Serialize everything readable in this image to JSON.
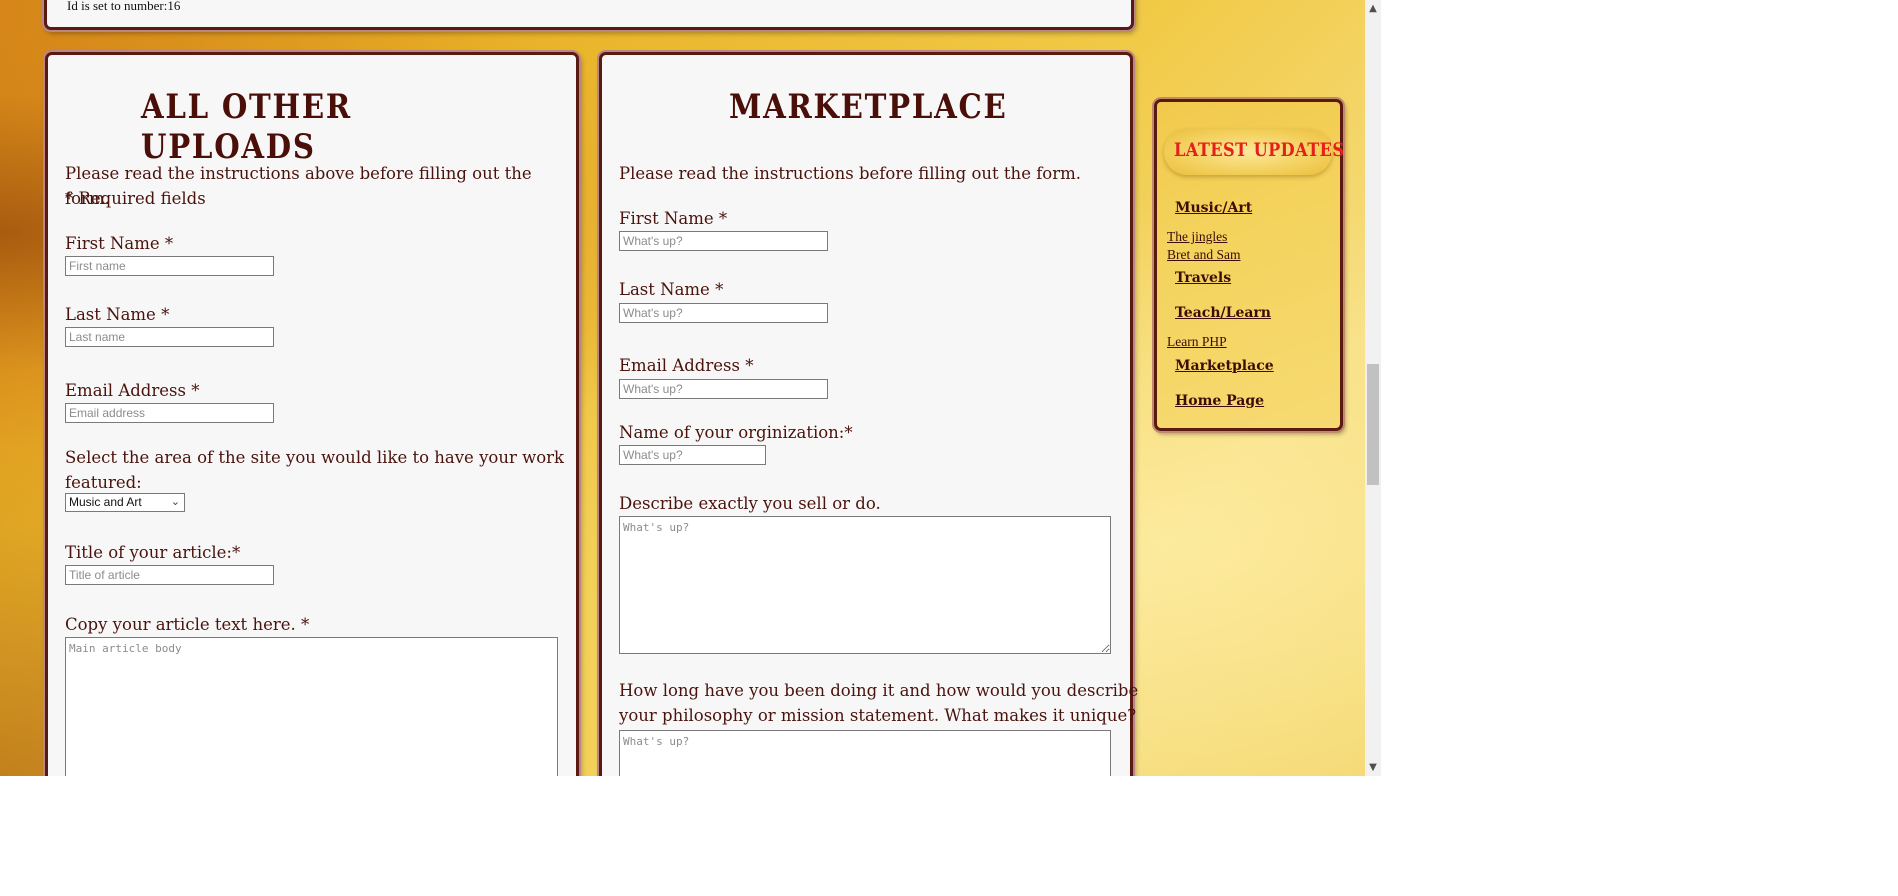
{
  "top_panel": {
    "note": "Id is set to number:16"
  },
  "uploads": {
    "title": "ALL OTHER UPLOADS",
    "instructions": "Please read the instructions above before filling out the form.",
    "required_note": "* Required fields",
    "first_name_label": "First Name *",
    "first_name_placeholder": "First name",
    "last_name_label": "Last Name *",
    "last_name_placeholder": "Last name",
    "email_label": "Email Address *",
    "email_placeholder": "Email address",
    "area_label_1": "Select the area of the site you would like to have your work",
    "area_label_2": "featured:",
    "area_selected": "Music and Art",
    "article_title_label": "Title of your article:*",
    "article_title_placeholder": "Title of article",
    "article_body_label": "Copy your article text here. *",
    "article_body_placeholder": "Main article body"
  },
  "marketplace": {
    "title": "MARKETPLACE",
    "instructions": "Please read the instructions before filling out the form.",
    "first_name_label": "First Name *",
    "last_name_label": "Last Name *",
    "email_label": "Email Address *",
    "org_label": "Name of your orginization:*",
    "describe_label": "Describe exactly you sell or do.",
    "philosophy_label_1": "How long have you been doing it and how would you describe",
    "philosophy_label_2": "your philosophy or mission statement. What makes it unique?",
    "placeholder": "What's up?"
  },
  "sidebar": {
    "heading": "LATEST UPDATES",
    "music_art": "Music/Art",
    "jingles": "The jingles",
    "bret_sam": "Bret and Sam",
    "travels": "Travels",
    "teach_learn": "Teach/Learn",
    "learn_php": "Learn PHP",
    "marketplace": "Marketplace",
    "home_page": "Home Page"
  },
  "colors": {
    "heading_dark": "#4a0f08",
    "latest_red": "#e4201a",
    "border": "#5a1a10"
  }
}
